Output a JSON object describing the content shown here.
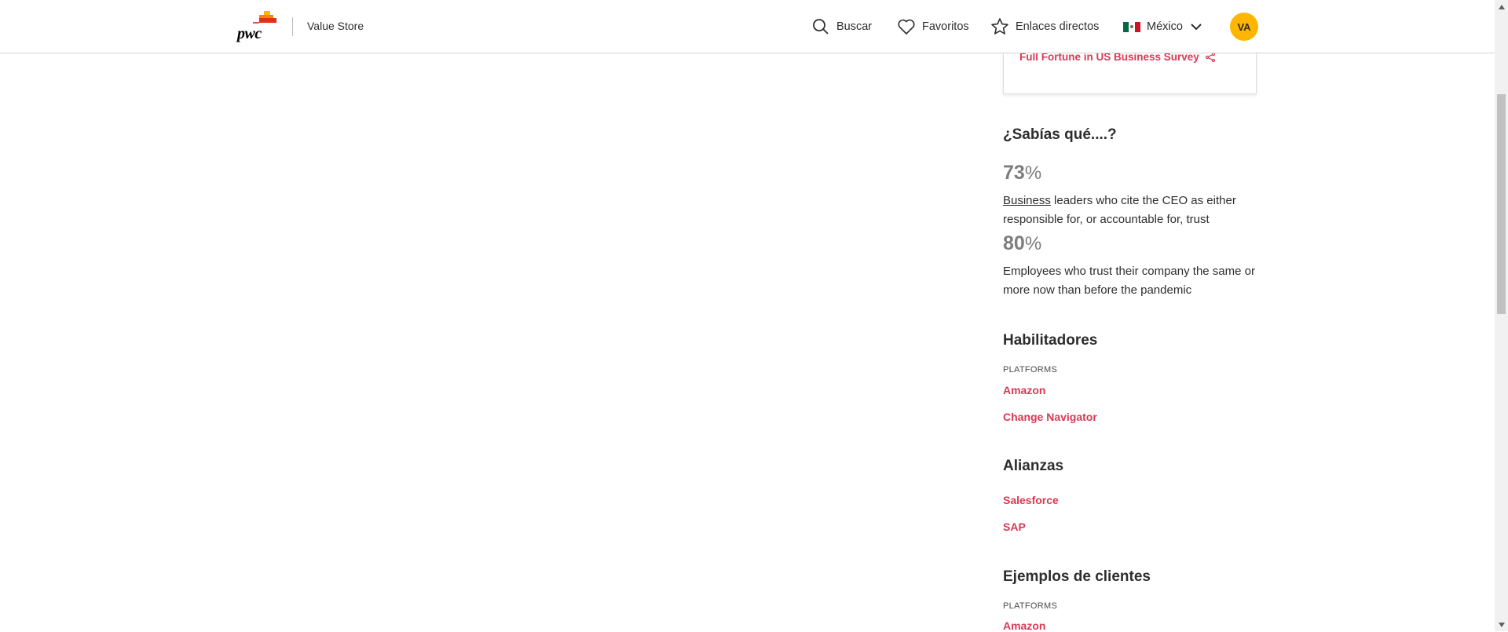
{
  "header": {
    "brand_logo_text": "pwc",
    "brand_title": "Value Store",
    "nav": {
      "search": "Buscar",
      "favorites": "Favoritos",
      "shortcuts": "Enlaces directos",
      "country": "México"
    },
    "avatar_initials": "VA"
  },
  "card": {
    "link": "Full Fortune in US Business Survey"
  },
  "did_you_know": {
    "title": "¿Sabías qué....?",
    "stats": [
      {
        "value": "73",
        "unit": "%",
        "text_link": "Business",
        "text": " leaders who cite the CEO as either responsible for, or accountable for, trust"
      },
      {
        "value": "80",
        "unit": "%",
        "text": "Employees who trust their company the same or more now than before the pandemic"
      }
    ]
  },
  "enablers": {
    "title": "Habilitadores",
    "category": "PLATFORMS",
    "links": [
      "Amazon",
      "Change Navigator"
    ]
  },
  "alliances": {
    "title": "Alianzas",
    "links": [
      "Salesforce",
      "SAP"
    ]
  },
  "client_examples": {
    "title": "Ejemplos de clientes",
    "category": "PLATFORMS",
    "links": [
      "Amazon"
    ]
  },
  "colors": {
    "accent": "#d93954",
    "avatar": "#ffb600",
    "stat": "#7d7d7d"
  },
  "icons": [
    "search-icon",
    "heart-icon",
    "star-icon",
    "mexico-flag-icon",
    "chevron-down-icon",
    "share-icon"
  ]
}
